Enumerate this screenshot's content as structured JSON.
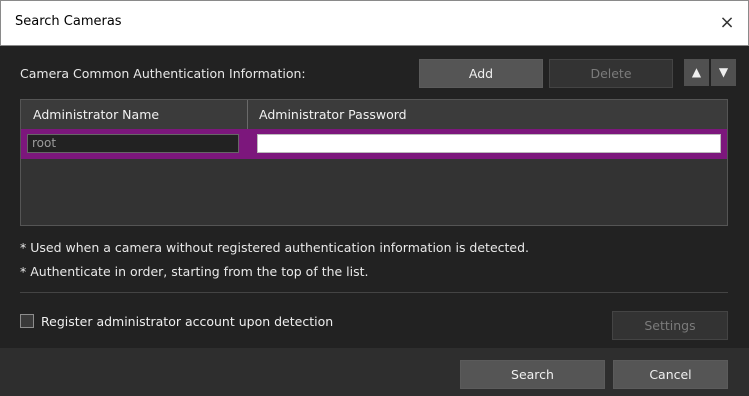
{
  "window": {
    "title": "Search Cameras",
    "close_glyph": "×"
  },
  "auth": {
    "label": "Camera Common Authentication Information:",
    "add": "Add",
    "delete": "Delete",
    "up_glyph": "▲",
    "down_glyph": "▼"
  },
  "table": {
    "headers": [
      "Administrator Name",
      "Administrator Password"
    ],
    "rows": [
      {
        "name": "root",
        "password": ""
      }
    ]
  },
  "notes": [
    "* Used when a camera without registered authentication information is detected.",
    "* Authenticate in order, starting from the top of the list."
  ],
  "register": {
    "label": "Register administrator account upon detection",
    "checked": false
  },
  "settings": "Settings",
  "footer": {
    "search": "Search",
    "cancel": "Cancel"
  },
  "colors": {
    "accent": "#7c177c"
  }
}
